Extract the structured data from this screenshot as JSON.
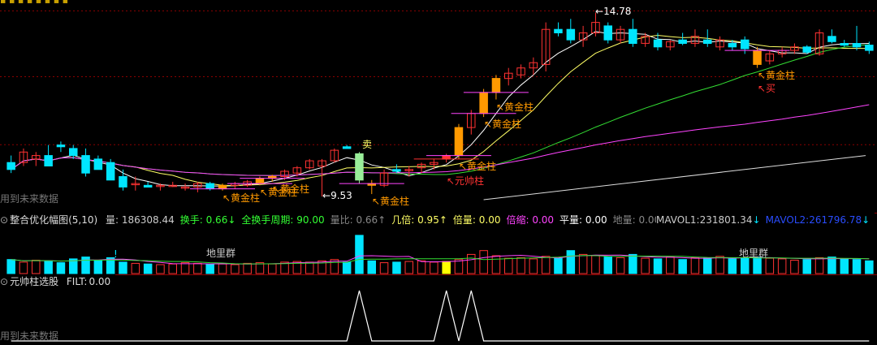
{
  "colors": {
    "bg": "#000000",
    "up": "#ff3232",
    "down": "#00e5ff",
    "gold": "#ff9900",
    "ma1": "#ffffff",
    "ma2": "#ffff66",
    "ma3": "#33dd33",
    "ma4": "#ff44ff",
    "grid": "#8b0000"
  },
  "main": {
    "price_high_label": "14.78",
    "price_low_label": "9.53",
    "watermark": "用到未来数据",
    "labels": {
      "golden_bar": "黄金柱",
      "marshal_bar": "元帅柱",
      "sell": "卖",
      "buy": "买"
    }
  },
  "volume_header": {
    "title": "整合优化幅图(5,10)",
    "items": [
      {
        "label": "量:",
        "value": "186308.44",
        "arrow": "",
        "color": "#cccccc"
      },
      {
        "label": "换手:",
        "value": "0.66",
        "arrow": "↓",
        "color": "#33ff33"
      },
      {
        "label": "全换手周期:",
        "value": "90.00",
        "arrow": "",
        "color": "#33ff33"
      },
      {
        "label": "量比:",
        "value": "0.66",
        "arrow": "↑",
        "color": "#888888"
      },
      {
        "label": "几倍:",
        "value": "0.95",
        "arrow": "↑",
        "color": "#ffff66"
      },
      {
        "label": "倍量:",
        "value": "0.00",
        "arrow": "",
        "color": "#ffff66"
      },
      {
        "label": "倍缩:",
        "value": "0.00",
        "arrow": "",
        "color": "#ff44ff"
      },
      {
        "label": "平量:",
        "value": "0.00",
        "arrow": "",
        "color": "#ffffff"
      },
      {
        "label": "地量:",
        "value": "0.00",
        "arrow": "",
        "color": "#888888"
      }
    ],
    "mavol1": {
      "label": "MAVOL1:",
      "value": "231801.34",
      "arrow": "↓"
    },
    "mavol2": {
      "label": "MAVOL2:",
      "value": "261796.78",
      "arrow": "↓"
    },
    "ground_label": "地里群",
    "excl": "!"
  },
  "signal_header": {
    "title": "元帅柱选股",
    "filt_label": "FILT:",
    "filt_value": "0.00",
    "watermark": "用到未来数据"
  },
  "chart_data": [
    {
      "type": "candlestick",
      "title": "",
      "ylim": [
        9.3,
        15.0
      ],
      "price_labels": {
        "high": 14.78,
        "low": 9.53
      },
      "candles": [
        {
          "o": 10.5,
          "h": 10.7,
          "l": 10.2,
          "c": 10.3
        },
        {
          "o": 10.5,
          "h": 10.9,
          "l": 10.4,
          "c": 10.8
        },
        {
          "o": 10.6,
          "h": 10.8,
          "l": 10.4,
          "c": 10.7
        },
        {
          "o": 10.7,
          "h": 11.0,
          "l": 10.4,
          "c": 10.4
        },
        {
          "o": 11.0,
          "h": 11.1,
          "l": 10.8,
          "c": 10.95
        },
        {
          "o": 10.9,
          "h": 11.0,
          "l": 10.6,
          "c": 10.7
        },
        {
          "o": 10.7,
          "h": 10.9,
          "l": 10.1,
          "c": 10.2
        },
        {
          "o": 10.6,
          "h": 10.7,
          "l": 10.3,
          "c": 10.3
        },
        {
          "o": 10.5,
          "h": 10.6,
          "l": 10.0,
          "c": 10.0
        },
        {
          "o": 10.1,
          "h": 10.3,
          "l": 9.7,
          "c": 9.8
        },
        {
          "o": 9.9,
          "h": 10.1,
          "l": 9.7,
          "c": 9.9
        },
        {
          "o": 9.85,
          "h": 9.95,
          "l": 9.8,
          "c": 9.8
        },
        {
          "o": 9.85,
          "h": 9.9,
          "l": 9.7,
          "c": 9.85
        },
        {
          "o": 9.85,
          "h": 9.95,
          "l": 9.8,
          "c": 9.85
        },
        {
          "o": 9.8,
          "h": 9.9,
          "l": 9.7,
          "c": 9.8
        },
        {
          "o": 9.8,
          "h": 9.95,
          "l": 9.65,
          "c": 9.9
        },
        {
          "o": 9.9,
          "h": 9.95,
          "l": 9.7,
          "c": 9.75
        },
        {
          "o": 9.75,
          "h": 9.9,
          "l": 9.7,
          "c": 9.85,
          "g": 1
        },
        {
          "o": 9.85,
          "h": 9.95,
          "l": 9.75,
          "c": 9.9
        },
        {
          "o": 9.85,
          "h": 10.0,
          "l": 9.8,
          "c": 9.95
        },
        {
          "o": 9.9,
          "h": 10.1,
          "l": 9.85,
          "c": 10.05,
          "g": 1
        },
        {
          "o": 10.05,
          "h": 10.15,
          "l": 9.95,
          "c": 10.1,
          "g": 1
        },
        {
          "o": 10.1,
          "h": 10.3,
          "l": 10.0,
          "c": 10.25
        },
        {
          "o": 10.2,
          "h": 10.4,
          "l": 10.1,
          "c": 10.35
        },
        {
          "o": 10.35,
          "h": 10.6,
          "l": 10.3,
          "c": 10.55
        },
        {
          "o": 10.4,
          "h": 10.6,
          "l": 9.53,
          "c": 10.55
        },
        {
          "o": 10.55,
          "h": 10.9,
          "l": 10.5,
          "c": 10.85
        },
        {
          "o": 10.95,
          "h": 11.0,
          "l": 10.9,
          "c": 10.9
        },
        {
          "o": 10.75,
          "h": 10.8,
          "l": 9.9,
          "c": 10.0,
          "sell": 1
        },
        {
          "o": 9.9,
          "h": 10.0,
          "l": 9.6,
          "c": 9.85,
          "g": 1
        },
        {
          "o": 9.85,
          "h": 10.3,
          "l": 9.8,
          "c": 10.2
        },
        {
          "o": 10.3,
          "h": 10.45,
          "l": 10.2,
          "c": 10.25
        },
        {
          "o": 10.3,
          "h": 10.4,
          "l": 10.1,
          "c": 10.3
        },
        {
          "o": 10.35,
          "h": 10.5,
          "l": 10.2,
          "c": 10.45
        },
        {
          "o": 10.45,
          "h": 10.6,
          "l": 10.3,
          "c": 10.5
        },
        {
          "o": 10.6,
          "h": 10.75,
          "l": 10.5,
          "c": 10.7,
          "m": 1
        },
        {
          "o": 10.7,
          "h": 11.6,
          "l": 10.6,
          "c": 11.5,
          "g": 1
        },
        {
          "o": 11.5,
          "h": 12.0,
          "l": 11.3,
          "c": 11.9
        },
        {
          "o": 11.9,
          "h": 12.6,
          "l": 11.8,
          "c": 12.5,
          "g": 1
        },
        {
          "o": 12.5,
          "h": 13.0,
          "l": 12.3,
          "c": 12.9,
          "g": 1
        },
        {
          "o": 12.9,
          "h": 13.2,
          "l": 12.7,
          "c": 13.05
        },
        {
          "o": 13.0,
          "h": 13.3,
          "l": 12.9,
          "c": 13.2
        },
        {
          "o": 13.2,
          "h": 13.5,
          "l": 13.0,
          "c": 13.35
        },
        {
          "o": 13.3,
          "h": 14.5,
          "l": 13.1,
          "c": 14.3
        },
        {
          "o": 14.3,
          "h": 14.5,
          "l": 14.1,
          "c": 14.2
        },
        {
          "o": 14.3,
          "h": 14.6,
          "l": 13.9,
          "c": 14.0
        },
        {
          "o": 14.0,
          "h": 14.4,
          "l": 13.8,
          "c": 14.2
        },
        {
          "o": 14.2,
          "h": 14.78,
          "l": 14.1,
          "c": 14.5
        },
        {
          "o": 14.4,
          "h": 14.5,
          "l": 13.9,
          "c": 14.0
        },
        {
          "o": 14.0,
          "h": 14.4,
          "l": 13.9,
          "c": 14.3
        },
        {
          "o": 14.3,
          "h": 14.6,
          "l": 13.8,
          "c": 13.9
        },
        {
          "o": 13.9,
          "h": 14.2,
          "l": 13.8,
          "c": 14.1
        },
        {
          "o": 14.0,
          "h": 14.2,
          "l": 13.7,
          "c": 13.8
        },
        {
          "o": 13.8,
          "h": 14.0,
          "l": 13.7,
          "c": 13.95
        },
        {
          "o": 14.0,
          "h": 14.2,
          "l": 13.85,
          "c": 13.9
        },
        {
          "o": 13.9,
          "h": 14.3,
          "l": 13.8,
          "c": 14.1
        },
        {
          "o": 14.0,
          "h": 14.3,
          "l": 13.8,
          "c": 13.9
        },
        {
          "o": 13.8,
          "h": 14.1,
          "l": 13.7,
          "c": 14.0
        },
        {
          "o": 13.9,
          "h": 14.0,
          "l": 13.7,
          "c": 13.8
        },
        {
          "o": 14.0,
          "h": 14.1,
          "l": 13.6,
          "c": 13.75
        },
        {
          "o": 13.7,
          "h": 13.8,
          "l": 13.2,
          "c": 13.3,
          "g": 1
        },
        {
          "o": 13.4,
          "h": 13.7,
          "l": 13.3,
          "c": 13.6
        },
        {
          "o": 13.6,
          "h": 13.8,
          "l": 13.5,
          "c": 13.7
        },
        {
          "o": 13.7,
          "h": 13.9,
          "l": 13.6,
          "c": 13.8
        },
        {
          "o": 13.8,
          "h": 13.85,
          "l": 13.6,
          "c": 13.65
        },
        {
          "o": 13.6,
          "h": 14.3,
          "l": 13.55,
          "c": 14.2
        },
        {
          "o": 14.1,
          "h": 14.3,
          "l": 13.9,
          "c": 13.95
        },
        {
          "o": 13.9,
          "h": 14.0,
          "l": 13.8,
          "c": 13.85
        },
        {
          "o": 13.9,
          "h": 14.4,
          "l": 13.7,
          "c": 13.8
        },
        {
          "o": 13.85,
          "h": 13.95,
          "l": 13.6,
          "c": 13.7
        }
      ]
    },
    {
      "type": "bar",
      "title": "",
      "ylim": [
        0,
        700000
      ],
      "values": [
        220000,
        180000,
        210000,
        200000,
        170000,
        230000,
        260000,
        210000,
        250000,
        180000,
        160000,
        150000,
        140000,
        150000,
        170000,
        160000,
        140000,
        150000,
        140000,
        160000,
        170000,
        150000,
        180000,
        190000,
        180000,
        200000,
        220000,
        180000,
        600000,
        200000,
        170000,
        180000,
        190000,
        200000,
        180000,
        190000,
        220000,
        300000,
        360000,
        280000,
        240000,
        250000,
        230000,
        270000,
        240000,
        360000,
        300000,
        280000,
        260000,
        250000,
        300000,
        240000,
        230000,
        260000,
        220000,
        250000,
        240000,
        270000,
        230000,
        250000,
        260000,
        240000,
        230000,
        210000,
        220000,
        250000,
        260000,
        230000,
        220000,
        200000
      ]
    },
    {
      "type": "line",
      "title": "",
      "ylim": [
        0,
        1
      ],
      "values": [
        0,
        0,
        0,
        0,
        0,
        0,
        0,
        0,
        0,
        0,
        0,
        0,
        0,
        0,
        0,
        0,
        0,
        0,
        0,
        0,
        0,
        0,
        0,
        0,
        0,
        0,
        0,
        0,
        1,
        0,
        0,
        0,
        0,
        0,
        0,
        1,
        0,
        1,
        0,
        0,
        0,
        0,
        0,
        0,
        0,
        0,
        0,
        0,
        0,
        0,
        0,
        0,
        0,
        0,
        0,
        0,
        0,
        0,
        0,
        0,
        0,
        0,
        0,
        0,
        0,
        0,
        0,
        0,
        0,
        0
      ]
    }
  ]
}
